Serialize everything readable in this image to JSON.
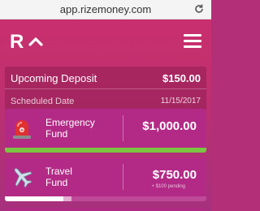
{
  "browser": {
    "url": "app.rizemoney.com",
    "reload_icon": "reload-icon"
  },
  "header": {
    "logo_letter": "R",
    "logo_icon": "chevron-up-icon",
    "menu_icon": "hamburger-menu-icon"
  },
  "deposit": {
    "title": "Upcoming Deposit",
    "amount": "$150.00",
    "scheduled_label": "Scheduled Date",
    "scheduled_date": "11/15/2017"
  },
  "funds": [
    {
      "name": "Emergency Fund",
      "name_line1": "Emergency",
      "name_line2": "Fund",
      "amount": "$1,000.00",
      "icon": "alarm-light-icon",
      "progress_fraction": 1.0,
      "progress_color": "#7ac542"
    },
    {
      "name": "Travel Fund",
      "name_line1": "Travel",
      "name_line2": "Fund",
      "amount": "$750.00",
      "pending": "+ $100 pending",
      "icon": "airplane-icon",
      "progress_fraction": 0.29,
      "pending_fraction": 0.04,
      "progress_color": "#ffffff"
    }
  ],
  "colors": {
    "brand": "#c2306f",
    "card": "#b32a86",
    "success": "#7ac542"
  }
}
